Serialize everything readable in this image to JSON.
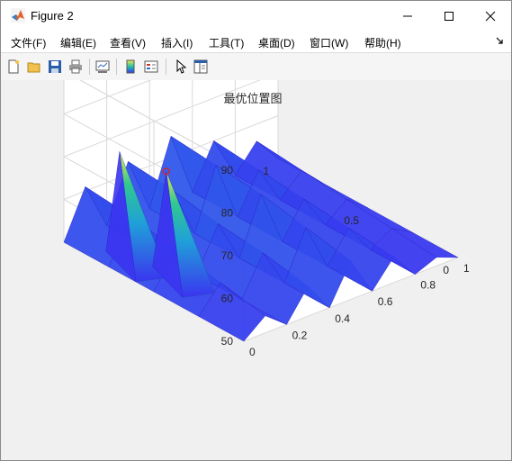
{
  "window": {
    "title": "Figure 2",
    "controls": [
      "minimize",
      "maximize",
      "close"
    ]
  },
  "menubar": {
    "items": [
      "文件(F)",
      "编辑(E)",
      "查看(V)",
      "插入(I)",
      "工具(T)",
      "桌面(D)",
      "窗口(W)",
      "帮助(H)"
    ]
  },
  "toolbar": {
    "icons": [
      "new-figure-icon",
      "open-file-icon",
      "save-icon",
      "print-icon",
      "link-plot-icon",
      "insert-colorbar-icon",
      "insert-legend-icon",
      "edit-plot-arrow-icon",
      "property-inspector-icon"
    ]
  },
  "colors": {
    "surface_low": "#3b34f0",
    "surface_high": "#f2e94e",
    "marker": "#e02020",
    "grid": "#d9d9d9",
    "axes_text": "#262626"
  },
  "chart_data": {
    "type": "surface3d",
    "title": "最优位置图",
    "xlabel": "",
    "ylabel": "",
    "zlabel": "",
    "x_ticks": [
      "0",
      "0.2",
      "0.4",
      "0.6",
      "0.8",
      "1"
    ],
    "y_ticks": [
      "0",
      "0.5",
      "1"
    ],
    "z_ticks": [
      "50",
      "60",
      "70",
      "80",
      "90"
    ],
    "xlim": [
      0,
      1
    ],
    "ylim": [
      0,
      1
    ],
    "zlim": [
      50,
      90
    ],
    "grid": true,
    "colormap": "parula",
    "surface": {
      "x": [
        0,
        0.1,
        0.2,
        0.3,
        0.4,
        0.5,
        0.6,
        0.7,
        0.8,
        0.9,
        1
      ],
      "y": [
        0,
        0.25,
        0.5,
        0.75,
        1
      ],
      "z": [
        [
          50,
          50,
          50,
          50,
          50
        ],
        [
          54,
          56,
          58,
          60,
          61
        ],
        [
          50,
          50,
          50,
          50,
          50
        ],
        [
          57,
          59,
          60,
          62,
          63
        ],
        [
          50,
          50,
          50,
          50,
          50
        ],
        [
          59,
          61,
          63,
          64,
          65
        ],
        [
          50,
          50,
          50,
          50,
          50
        ],
        [
          56,
          57,
          58,
          59,
          60
        ],
        [
          50,
          50,
          50,
          50,
          50
        ],
        [
          52,
          53,
          54,
          55,
          56
        ],
        [
          50,
          50,
          50,
          50,
          50
        ]
      ]
    },
    "peaks": [
      {
        "x": 0.05,
        "y": 0.75,
        "z": 76
      },
      {
        "x": 0.1,
        "y": 0.55,
        "z": 75
      }
    ],
    "optimum_marker": {
      "x": 0.1,
      "y": 0.55,
      "z": 75
    }
  }
}
